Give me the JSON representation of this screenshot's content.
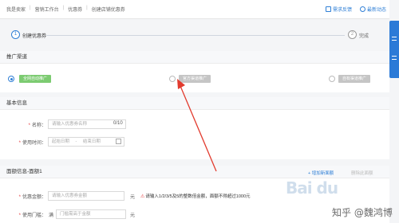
{
  "breadcrumb": [
    "我是卖家",
    "营销工作台",
    "优惠券",
    "创建店铺优惠券"
  ],
  "breadcrumb_sep": "|",
  "top_actions": {
    "feedback": "需求反馈",
    "news": "最新动态"
  },
  "steps": [
    {
      "num": "1",
      "label": "创建优惠券"
    },
    {
      "num": "2",
      "label": "完成"
    }
  ],
  "channel_section": {
    "title": "推广渠道",
    "options": [
      {
        "label": "全网自动推广",
        "selected": true
      },
      {
        "label": "官方渠道推广",
        "selected": false
      },
      {
        "label": "自有渠道推广",
        "selected": false
      }
    ]
  },
  "basic_section": {
    "title": "基本信息",
    "name_label": "名称：",
    "name_placeholder": "请输入优惠券名称",
    "name_counter": "0/10",
    "time_label": "使用时间：",
    "start_placeholder": "起始日期",
    "time_sep": "-",
    "end_placeholder": "结束日期"
  },
  "denomination_section": {
    "title": "面额信息-面额1",
    "add_link": "+ 增加新面额",
    "delete_link": "删除此面额",
    "amount_label": "优惠金额：",
    "amount_placeholder": "请输入优惠券金额",
    "amount_unit": "元",
    "amount_warning": "请输入1/2/3/5及5的整数倍金额，面额不得超过1000元",
    "threshold_label": "使用门槛：",
    "threshold_prefix": "满",
    "threshold_placeholder": "门槛需高于金额",
    "threshold_unit": "元"
  },
  "watermarks": {
    "baidu": "Bai du",
    "zhihu": "知乎 @魏鸿博"
  },
  "colors": {
    "accent": "#2f7fd6",
    "green_pill": "#7ccb71",
    "gray_pill": "#c5c5c5",
    "arrow": "#e23b2e"
  }
}
